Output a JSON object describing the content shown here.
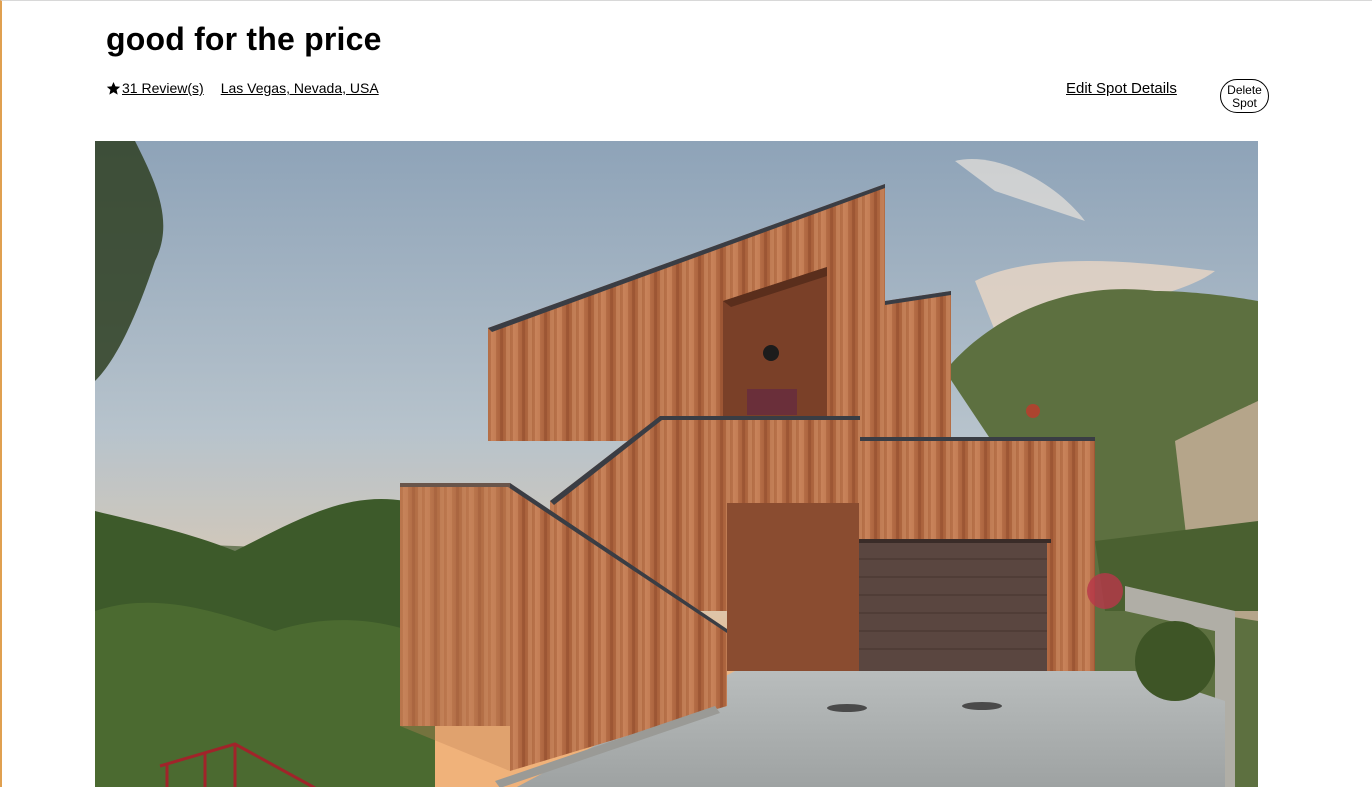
{
  "spot": {
    "title": "good for the price",
    "reviews_label": "31 Review(s)",
    "location": "Las Vegas, Nevada, USA"
  },
  "actions": {
    "edit_label": "Edit Spot Details",
    "delete_label": "Delete Spot"
  },
  "icons": {
    "rating": "star-icon"
  },
  "image": {
    "alt": "Modern wooden house with garage on a hillside at sunset"
  },
  "colors": {
    "text": "#000000",
    "background": "#ffffff",
    "wood": "#b56a43",
    "garage_door": "#5a4640"
  }
}
